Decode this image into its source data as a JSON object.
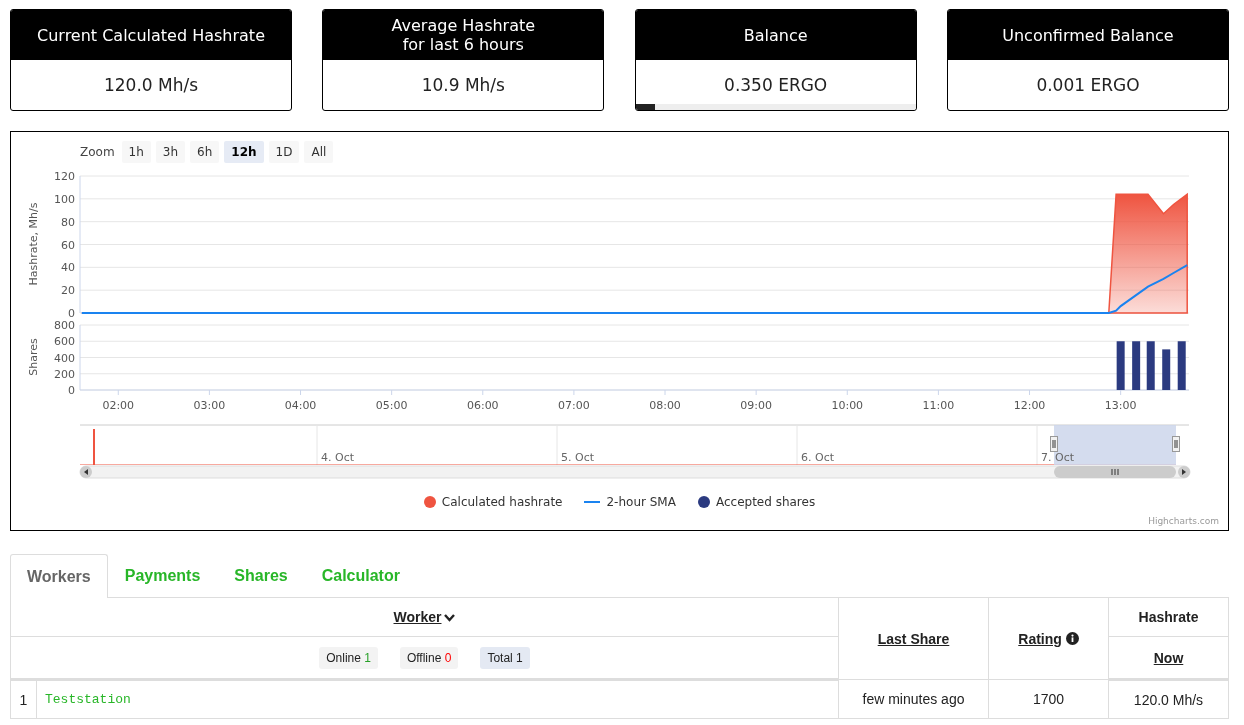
{
  "stat_cards": [
    {
      "title": "Current Calculated Hashrate",
      "value": "120.0 Mh/s"
    },
    {
      "title": "Average Hashrate\nfor last 6 hours",
      "value": "10.9 Mh/s"
    },
    {
      "title": "Balance",
      "value": "0.350 ERGO",
      "level": 0.07
    },
    {
      "title": "Unconfirmed Balance",
      "value": "0.001 ERGO"
    }
  ],
  "chart": {
    "zoom_label": "Zoom",
    "zoom_buttons": [
      {
        "label": "1h",
        "selected": false
      },
      {
        "label": "3h",
        "selected": false
      },
      {
        "label": "6h",
        "selected": false
      },
      {
        "label": "12h",
        "selected": true
      },
      {
        "label": "1D",
        "selected": false
      },
      {
        "label": "All",
        "selected": false
      }
    ],
    "hashrate_pane": {
      "chart_data": {
        "type": "area",
        "ylabel": "Hashrate, Mh/s",
        "x": [
          1.6,
          12.87,
          12.95,
          13.0,
          13.3,
          13.47,
          13.58,
          13.73
        ],
        "xlim": [
          1.58,
          13.75
        ],
        "ylim": [
          0,
          120
        ],
        "yticks": [
          0,
          20,
          40,
          60,
          80,
          100,
          120
        ],
        "series": [
          {
            "name": "Calculated hashrate",
            "type": "area",
            "color": "#ef5440",
            "values": [
              0,
              0,
              104,
              104,
              104,
              87,
              95,
              104
            ]
          },
          {
            "name": "2-hour SMA",
            "type": "line",
            "color": "#1a83f0",
            "values": [
              0,
              0,
              2,
              6,
              23,
              30,
              35,
              42
            ]
          }
        ],
        "grid": true
      }
    },
    "shares_pane": {
      "chart_data": {
        "type": "bar",
        "ylabel": "Shares",
        "x": [
          13.0,
          13.17,
          13.33,
          13.5,
          13.67
        ],
        "xlim": [
          1.58,
          13.75
        ],
        "ylim": [
          0,
          800
        ],
        "yticks": [
          0,
          200,
          400,
          600,
          800
        ],
        "xticks": [
          {
            "value": 2,
            "label": "02:00"
          },
          {
            "value": 3,
            "label": "03:00"
          },
          {
            "value": 4,
            "label": "04:00"
          },
          {
            "value": 5,
            "label": "05:00"
          },
          {
            "value": 6,
            "label": "06:00"
          },
          {
            "value": 7,
            "label": "07:00"
          },
          {
            "value": 8,
            "label": "08:00"
          },
          {
            "value": 9,
            "label": "09:00"
          },
          {
            "value": 10,
            "label": "10:00"
          },
          {
            "value": 11,
            "label": "11:00"
          },
          {
            "value": 12,
            "label": "12:00"
          },
          {
            "value": 13,
            "label": "13:00"
          }
        ],
        "series": [
          {
            "name": "Accepted shares",
            "color": "#2b3a80",
            "values": [
              600,
              600,
              600,
              500,
              600
            ]
          }
        ],
        "grid": true
      }
    },
    "navigator_labels": [
      "4. Oct",
      "5. Oct",
      "6. Oct",
      "7. Oct"
    ],
    "credits": "Highcharts.com"
  },
  "tabs": [
    {
      "label": "Workers",
      "selected": true
    },
    {
      "label": "Payments",
      "selected": false
    },
    {
      "label": "Shares",
      "selected": false
    },
    {
      "label": "Calculator",
      "selected": false
    }
  ],
  "workers_table": {
    "columns": {
      "worker": "Worker",
      "last_share": "Last Share",
      "rating": "Rating",
      "hashrate": "Hashrate",
      "hashrate_now": "Now"
    },
    "filters": [
      {
        "kind": "online",
        "label": "Online",
        "count": "1",
        "selected": false
      },
      {
        "kind": "offline",
        "label": "Offline",
        "count": "0",
        "selected": false
      },
      {
        "kind": "total",
        "label": "Total",
        "count": "1",
        "selected": true
      }
    ],
    "rows": [
      {
        "index": "1",
        "name": "Teststation",
        "last_share": "few minutes ago",
        "rating": "1700",
        "hashrate": "120.0 Mh/s"
      }
    ]
  }
}
